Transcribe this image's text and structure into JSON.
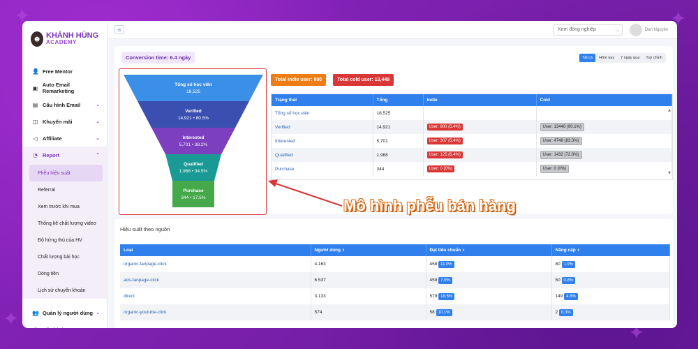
{
  "brand": {
    "logo_title": "KHÁNH HÙNG",
    "logo_sub": "ACADEMY"
  },
  "sidebar": {
    "items": [
      {
        "label": "Free Mentor",
        "icon": "user-icon",
        "glyph": "👤",
        "chevron": false
      },
      {
        "label": "Auto Email Remarketing",
        "icon": "mail-auto-icon",
        "glyph": "▣",
        "chevron": false
      },
      {
        "label": "Cấu hình Email",
        "icon": "briefcase-icon",
        "glyph": "▤",
        "chevron": true
      },
      {
        "label": "Khuyến mãi",
        "icon": "ticket-icon",
        "glyph": "◫",
        "chevron": true
      },
      {
        "label": "Affiliate",
        "icon": "share-icon",
        "glyph": "◁",
        "chevron": true
      },
      {
        "label": "Report",
        "icon": "chart-pie-icon",
        "glyph": "◔",
        "chevron": true,
        "active": true
      }
    ],
    "report_sub": [
      "Phễu hiệu suất",
      "Referral",
      "Xem trước khi mua",
      "Thống kê chất lượng video",
      "Độ hứng thú của HV",
      "Chất lượng bài học",
      "Dòng tiền",
      "Lịch sử chuyển khoản"
    ],
    "bottom": [
      {
        "label": "Quản lý người dùng",
        "icon": "users-icon",
        "glyph": "👥"
      },
      {
        "label": "Cấu hình",
        "icon": "gear-icon",
        "glyph": "⚙"
      }
    ]
  },
  "topbar": {
    "menu_icon": "≡",
    "colleague_placeholder": "Xem đồng nghiệp",
    "user_name": "Đan Nguyên"
  },
  "conversion": "Conversion time: 6.4 ngày",
  "ranges": [
    "Tất cả",
    "Hôm nay",
    "7 ngày qua",
    "Tuỳ chỉnh"
  ],
  "funnel": [
    {
      "name": "Tổng số học viên",
      "value": "18,525",
      "color": "#3b8fe6"
    },
    {
      "name": "Verified",
      "value": "14,921 • 80.5%",
      "color": "#3a4fb0"
    },
    {
      "name": "Interested",
      "value": "5,701 • 38.2%",
      "color": "#7b3fbf"
    },
    {
      "name": "Qualified",
      "value": "1.968 • 34.5%",
      "color": "#1a9a94"
    },
    {
      "name": "Purchase",
      "value": "344 • 17.5%",
      "color": "#45a84a"
    }
  ],
  "totals": {
    "indie": "Total indie user: 800",
    "cold": "Total cold user: 13,448"
  },
  "status_table": {
    "headers": [
      "Trạng thái",
      "Tổng",
      "Indie",
      "Cold"
    ],
    "rows": [
      {
        "status": "Tổng số học viên",
        "total": "18,525",
        "indie": "",
        "cold": ""
      },
      {
        "status": "Verified",
        "total": "14,921",
        "indie": "User: 800 (5.4%)",
        "cold": "User: 13448 (90.1%)"
      },
      {
        "status": "Interested",
        "total": "5,701",
        "indie": "User: 307 (5.4%)",
        "cold": "User: 4748 (83.3%)"
      },
      {
        "status": "Qualified",
        "total": "1.968",
        "indie": "User: 125 (6.4%)",
        "cold": "User: 1432 (72.8%)"
      },
      {
        "status": "Purchase",
        "total": "344",
        "indie": "User: 0 (0%)",
        "cold": "User: 0 (0%)"
      }
    ]
  },
  "annotation": "Mô hình phễu bán hàng",
  "source": {
    "title": "Hiệu suất theo nguồn",
    "headers": [
      "Loại",
      "Người dùng",
      "Đạt tiêu chuẩn",
      "Nâng cấp"
    ],
    "rows": [
      {
        "type": "organic-fanpage-click",
        "users": "4.163",
        "qual": "458",
        "qual_pct": "11.0%",
        "up": "80",
        "up_pct": "1.9%"
      },
      {
        "type": "ads-fanpage-click",
        "users": "6.537",
        "qual": "459",
        "qual_pct": "7.0%",
        "up": "50",
        "up_pct": "0.8%"
      },
      {
        "type": "direct",
        "users": "3.133",
        "qual": "579",
        "qual_pct": "18.5%",
        "up": "149",
        "up_pct": "4.8%"
      },
      {
        "type": "organic-youtube-click",
        "users": "574",
        "qual": "58",
        "qual_pct": "10.1%",
        "up": "2",
        "up_pct": "0.3%"
      }
    ]
  }
}
